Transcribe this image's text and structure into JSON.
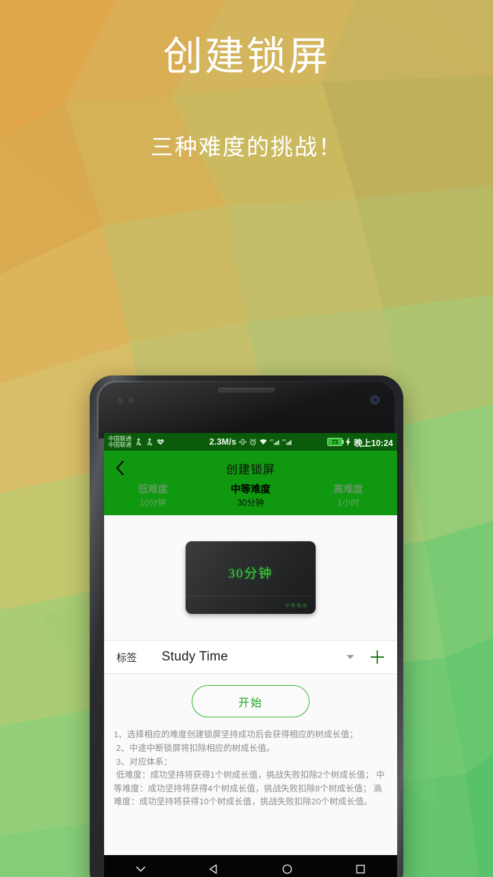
{
  "promo": {
    "title": "创建锁屏",
    "subtitle": "三种难度的挑战！"
  },
  "colors": {
    "app_green": "#109810",
    "status_green": "#0a5c0a",
    "accent_green": "#17a317",
    "card_dark": "#242628",
    "timer_green": "#37d437"
  },
  "statusbar": {
    "carrier_line1": "中国联通",
    "carrier_line2": "中国联通",
    "icons": [
      "usb-icon",
      "usb-icon",
      "heart-icon"
    ],
    "network_speed": "2.3M/s",
    "mid_icons": [
      "vibrate-icon",
      "alarm-icon",
      "wifi-icon"
    ],
    "signal_4g_label": "4G",
    "signal_2g_label": "2G",
    "battery_level": "73",
    "charging": true,
    "time": "晚上10:24"
  },
  "appbar": {
    "back_icon": "chevron-left-icon",
    "title": "创建锁屏",
    "difficulty_tabs": [
      {
        "name": "低难度",
        "duration": "10分钟",
        "active": false
      },
      {
        "name": "中等难度",
        "duration": "30分钟",
        "active": true
      },
      {
        "name": "高难度",
        "duration": "1小时",
        "active": false
      }
    ]
  },
  "timer_card": {
    "main_text": "30分钟",
    "badge_text": "中等难度"
  },
  "tag_row": {
    "label": "标签",
    "value": "Study Time",
    "caret_icon": "chevron-down-icon",
    "add_icon": "plus-icon"
  },
  "start_button": {
    "label": "开始"
  },
  "notes": {
    "text": "1、选择相应的难度创建锁屏坚持成功后会获得相应的树成长值；\n 2、中途中断锁屏将扣除相应的树成长值。\n 3、对应体系：\n 低难度：成功坚持将获得1个树成长值，挑战失败扣除2个树成长值； 中等难度：成功坚持将获得4个树成长值，挑战失败扣除8个树成长值； 高难度：成功坚持将获得10个树成长值，挑战失败扣除20个树成长值。"
  },
  "navbar": {
    "buttons": [
      "chevron-down-icon",
      "back-triangle-icon",
      "home-circle-icon",
      "recents-square-icon"
    ]
  }
}
